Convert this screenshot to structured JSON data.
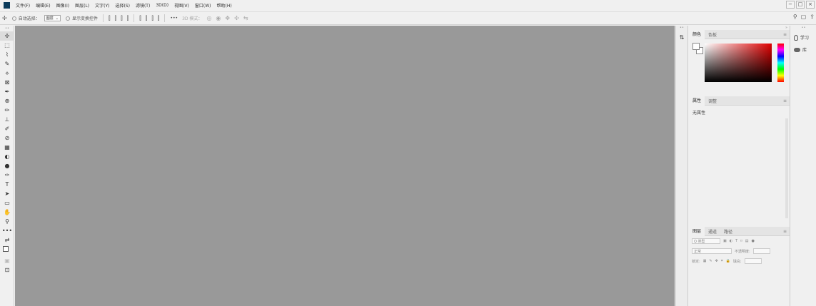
{
  "menubar": {
    "items": [
      "文件(F)",
      "编辑(E)",
      "图像(I)",
      "图层(L)",
      "文字(Y)",
      "选择(S)",
      "滤镜(T)",
      "3D(D)",
      "视图(V)",
      "窗口(W)",
      "帮助(H)"
    ],
    "window_controls": [
      "−",
      "□",
      "×"
    ]
  },
  "options": {
    "move_icon": "✢",
    "auto_select_label": "自动选择：",
    "auto_select_value": "图层",
    "show_transform_label": "显示变换控件",
    "align_icons": [
      "⫿",
      "⫿",
      "⫿",
      "⫿",
      "⫿",
      "⫿",
      "⫿",
      "⫿"
    ],
    "more_label": "•••",
    "mode_label": "3D 模式：",
    "right_icons": [
      "🔍",
      "▢",
      "⎙"
    ]
  },
  "tools": [
    "✢",
    "⬚",
    "⌇",
    "✎",
    "⟡",
    "⊠",
    "✒",
    "⊕",
    "✏",
    "⊥",
    "✐",
    "⊘",
    "▦",
    "◐",
    "●",
    "✑",
    "T",
    "➤",
    "▭",
    "✋",
    "⚲",
    "•••",
    "⇄",
    "▣",
    "▤",
    "⊡"
  ],
  "panels": {
    "color": {
      "tabs": [
        "颜色",
        "色板"
      ]
    },
    "properties": {
      "tabs": [
        "属性",
        "调整"
      ],
      "empty_text": "无属性"
    },
    "layers": {
      "tabs": [
        "图层",
        "通道",
        "路径"
      ],
      "kind_label": "Q 类型",
      "blend_mode": "正常",
      "opacity_label": "不透明度:",
      "lock_label": "锁定:",
      "fill_label": "填充:"
    }
  },
  "learn": {
    "learn_label": "学习",
    "library_label": "库"
  },
  "colors": {
    "canvas": "#999999",
    "accent": "#0a3a5a"
  }
}
